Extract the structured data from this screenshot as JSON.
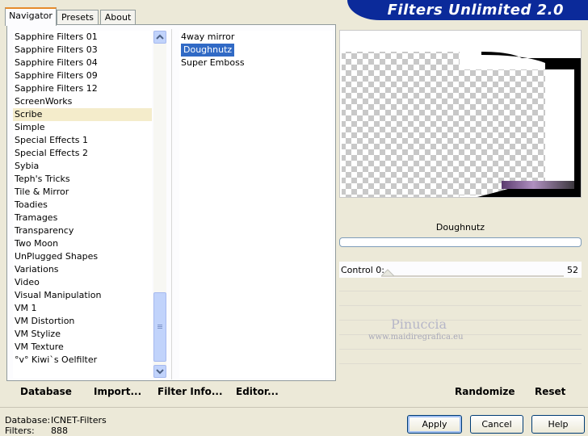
{
  "tabs": [
    "Navigator",
    "Presets",
    "About"
  ],
  "banner_title": "Filters Unlimited 2.0",
  "categories": [
    "Sapphire Filters 01",
    "Sapphire Filters 03",
    "Sapphire Filters 04",
    "Sapphire Filters 09",
    "Sapphire Filters 12",
    "ScreenWorks",
    "Scribe",
    "Simple",
    "Special Effects 1",
    "Special Effects 2",
    "Sybia",
    "Teph's Tricks",
    "Tile & Mirror",
    "Toadies",
    "Tramages",
    "Transparency",
    "Two Moon",
    "UnPlugged Shapes",
    "Variations",
    "Video",
    "Visual Manipulation",
    "VM 1",
    "VM Distortion",
    "VM Stylize",
    "VM Texture",
    "°v° Kiwi`s Oelfilter"
  ],
  "highlighted_category": "Scribe",
  "filters": [
    "4way mirror",
    "Doughnutz",
    "Super Emboss"
  ],
  "selected_filter": "Doughnutz",
  "filter_name": "Doughnutz",
  "control": {
    "label": "Control 0:",
    "value": "52"
  },
  "watermark": {
    "line1": "Pinuccia",
    "line2": "www.maidiregrafica.eu"
  },
  "left_buttons": {
    "database": "Database",
    "import": "Import...",
    "filter_info": "Filter Info...",
    "editor": "Editor..."
  },
  "right_buttons": {
    "randomize": "Randomize",
    "reset": "Reset"
  },
  "status": {
    "database_label": "Database:",
    "database_value": "ICNET-Filters",
    "filters_label": "Filters:",
    "filters_value": "888"
  },
  "dialog_buttons": {
    "apply": "Apply",
    "cancel": "Cancel",
    "help": "Help"
  }
}
